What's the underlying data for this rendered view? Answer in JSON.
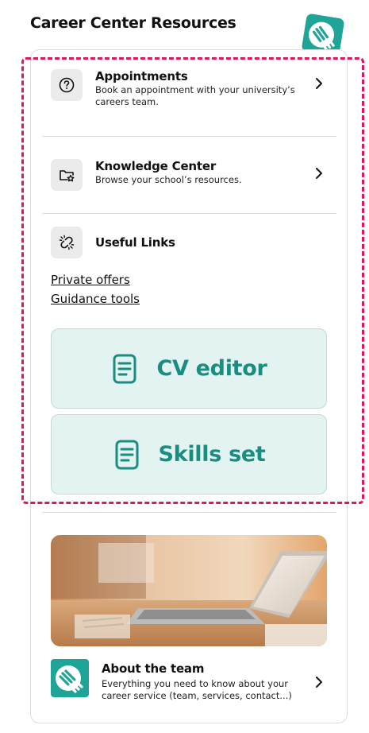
{
  "page": {
    "title": "Career Center Resources"
  },
  "brand": {
    "logo_icon": "career-service-logo",
    "teal": "#1fa597",
    "highlight_color": "#e0165c"
  },
  "resources": {
    "appointments": {
      "icon": "question-circle-icon",
      "title": "Appointments",
      "description": "Book an appointment with your university’s careers team."
    },
    "knowledge_center": {
      "icon": "folder-star-icon",
      "title": "Knowledge Center",
      "description": "Browse your school’s resources."
    },
    "useful_links": {
      "icon": "broken-link-icon",
      "title": "Useful Links",
      "links": [
        "Private offers",
        "Guidance tools"
      ]
    }
  },
  "tools": {
    "cv_editor": {
      "icon": "document-icon",
      "label": "CV editor"
    },
    "skills_set": {
      "icon": "document-icon",
      "label": "Skills set"
    }
  },
  "about": {
    "image": "laptop-on-desk-photo",
    "title": "About the team",
    "description": "Everything you need to know about your career service (team, services, contact...)"
  }
}
